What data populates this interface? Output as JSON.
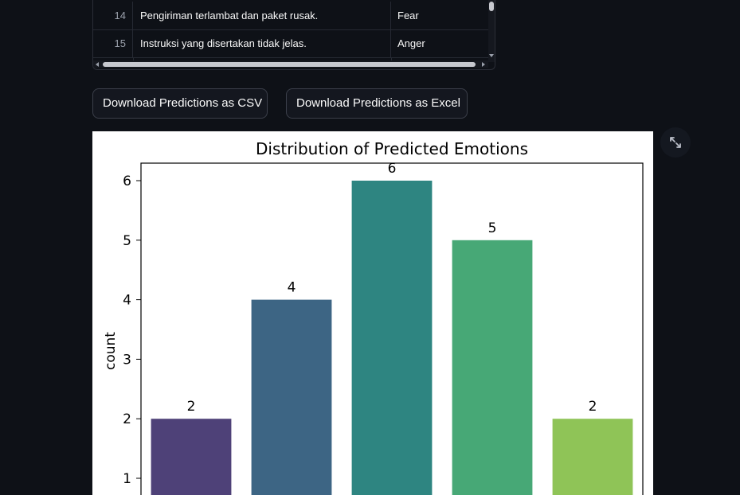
{
  "table": {
    "rows": [
      {
        "index": "14",
        "text": "Pengiriman terlambat dan paket rusak.",
        "emotion": "Fear"
      },
      {
        "index": "15",
        "text": "Instruksi yang disertakan tidak jelas.",
        "emotion": "Anger"
      }
    ]
  },
  "buttons": {
    "csv_label": "Download Predictions as CSV",
    "excel_label": "Download Predictions as Excel"
  },
  "icons": {
    "fullscreen": "expand-arrows-icon",
    "scroll_down": "chevron-down-icon",
    "scroll_left": "chevron-left-icon",
    "scroll_right": "chevron-right-icon"
  },
  "theme": {
    "background": "#0e1117",
    "text": "#fafafa"
  },
  "chart_data": {
    "type": "bar",
    "title": "Distribution of Predicted Emotions",
    "xlabel": "",
    "ylabel": "count",
    "categories": [
      "",
      "",
      "",
      "",
      ""
    ],
    "values": [
      2,
      4,
      6,
      5,
      2
    ],
    "bar_colors": [
      "#4e4178",
      "#3d6584",
      "#2e8581",
      "#47a876",
      "#8fc457"
    ],
    "yticks": [
      1,
      2,
      3,
      4,
      5,
      6
    ],
    "ylim": [
      0,
      6.3
    ],
    "grid": false,
    "legend": "none"
  }
}
